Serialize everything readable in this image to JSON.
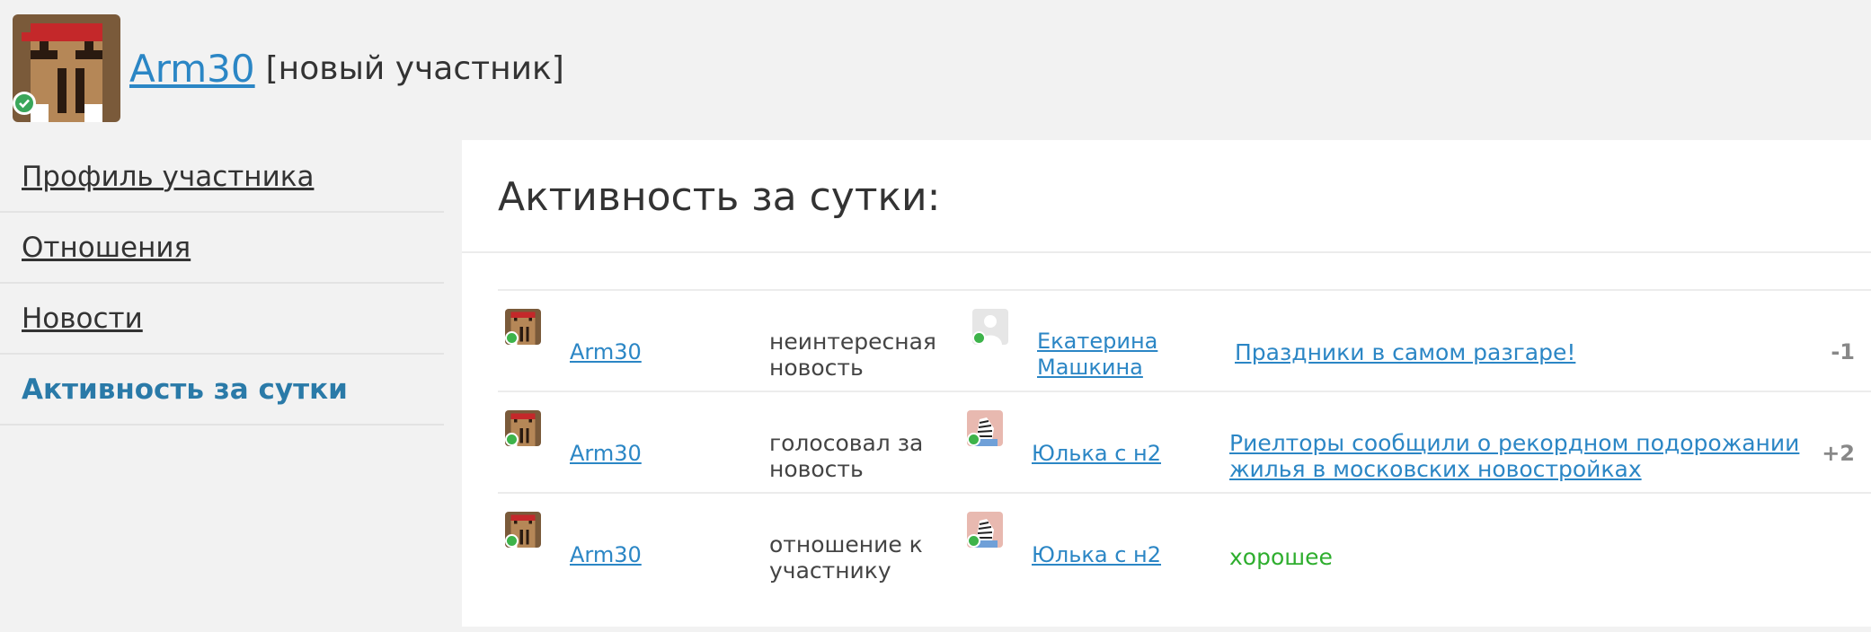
{
  "header": {
    "username": "Arm30",
    "status": "[новый участник]"
  },
  "sidebar": {
    "items": [
      {
        "label": "Профиль участника",
        "active": false
      },
      {
        "label": "Отношения",
        "active": false
      },
      {
        "label": "Новости",
        "active": false
      },
      {
        "label": "Активность за сутки",
        "active": true
      }
    ]
  },
  "main": {
    "title": "Активность за сутки:",
    "rows": [
      {
        "user": "Arm30",
        "action": "неинтересная новость",
        "target": "Екатерина Машкина",
        "target_avatar": "placeholder-avatar-icon",
        "object": "Праздники в самом разгаре!",
        "score": "-1"
      },
      {
        "user": "Arm30",
        "action": "голосовал за новость",
        "target": "Юлька с н2",
        "target_avatar": "zebra-avatar-icon",
        "object": "Риелторы сообщили о рекордном подорожании жилья в московских новостройках",
        "score": "+2"
      },
      {
        "user": "Arm30",
        "action": "отношение к участнику",
        "target": "Юлька с н2",
        "target_avatar": "zebra-avatar-icon",
        "object": "хорошее",
        "score": ""
      }
    ]
  },
  "colors": {
    "link": "#2b86c5",
    "active_nav": "#2a7aa8",
    "positive": "#2eae2e",
    "online": "#3db34a"
  }
}
